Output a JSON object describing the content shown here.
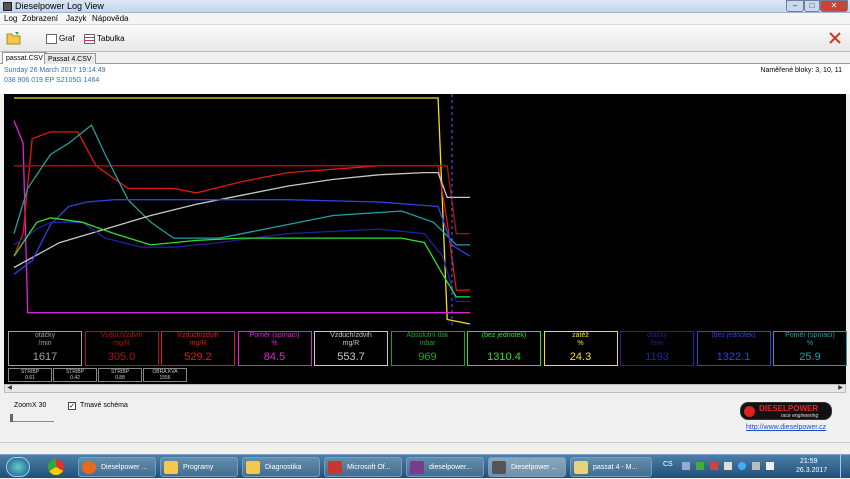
{
  "window": {
    "title": "Dieselpower Log View"
  },
  "menu": [
    "Log",
    "Zobrazení",
    "Jazyk",
    "Nápověda"
  ],
  "toolbar": {
    "graph_label": "Graf",
    "table_label": "Tabulka"
  },
  "tabs": [
    "passat.CSV",
    "Passat 4.CSV"
  ],
  "info": {
    "date": "Sunday 26 March 2017 19:14:49",
    "ecu": "038 906 019 EP  S2105G  1464",
    "measured_blocks": "Naměřené bloky: 3, 10, 11"
  },
  "channels": [
    {
      "name": "otáčky",
      "unit": "/min",
      "value": "1617",
      "color": "#a0a0a0"
    },
    {
      "name": "Vzduch/zdvih",
      "unit": "mg/R",
      "value": "305.0",
      "color": "#b01010"
    },
    {
      "name": "Vzduch/zdvih",
      "unit": "mg/R",
      "value": "529.2",
      "color": "#e01818"
    },
    {
      "name": "Poměr (spínací)",
      "unit": "%",
      "value": "84.5",
      "color": "#e020e0"
    },
    {
      "name": "Vzduch/zdvih",
      "unit": "mg/R",
      "value": "553.7",
      "color": "#c8c8c8"
    },
    {
      "name": "Absolutní tlak",
      "unit": "mbar",
      "value": "969",
      "color": "#20a020"
    },
    {
      "name": "(bez jednotek)",
      "unit": "",
      "value": "1310.4",
      "color": "#30e030"
    },
    {
      "name": "zátěž",
      "unit": "%",
      "value": "24.3",
      "color": "#f0e020"
    },
    {
      "name": "otáčky",
      "unit": "/min",
      "value": "1193",
      "color": "#2020a0"
    },
    {
      "name": "(bez jednotek)",
      "unit": "",
      "value": "1322.1",
      "color": "#3040e0"
    },
    {
      "name": "Poměr (spínací)",
      "unit": "%",
      "value": "25.9",
      "color": "#20a0a0"
    }
  ],
  "stat_boxes": [
    {
      "label": "STRIBP",
      "value": "0.61"
    },
    {
      "label": "STRIBP",
      "value": "0.42"
    },
    {
      "label": "STRIBP",
      "value": "0.88"
    },
    {
      "label": "OBRA.KVA",
      "value": "1556"
    }
  ],
  "bottom": {
    "zoom_label": "Zoom",
    "zoom_value": "X 30",
    "dark_scheme_label": "Tmavé schéma",
    "dark_scheme_checked": true,
    "logo_text": "DIESELPOWER",
    "logo_sub": "race engineering",
    "url": "http://www.dieselpower.cz"
  },
  "taskbar": {
    "items": [
      "Dieselpower ...",
      "Programy",
      "Diagnostika",
      "Microsoft Of...",
      "dieselpower...",
      "Dieselpower ...",
      "passat 4 - M..."
    ],
    "lang": "CS",
    "time": "21:59",
    "date": "26.3.2017"
  },
  "chart_data": {
    "type": "line",
    "x_range": [
      0,
      100
    ],
    "y_range": [
      0,
      100
    ],
    "grid": false,
    "series": [
      {
        "color": "#f0e020",
        "points": [
          [
            0,
            100
          ],
          [
            5,
            100
          ],
          [
            60,
            100
          ],
          [
            93,
            100
          ],
          [
            95,
            2
          ],
          [
            100,
            0
          ]
        ]
      },
      {
        "color": "#e020e0",
        "points": [
          [
            0,
            90
          ],
          [
            2,
            80
          ],
          [
            3,
            5
          ],
          [
            20,
            5
          ],
          [
            40,
            5
          ],
          [
            60,
            5
          ],
          [
            95,
            5
          ],
          [
            100,
            5
          ]
        ]
      },
      {
        "color": "#e01818",
        "points": [
          [
            0,
            30
          ],
          [
            2,
            40
          ],
          [
            4,
            82
          ],
          [
            8,
            85
          ],
          [
            14,
            85
          ],
          [
            18,
            70
          ],
          [
            25,
            60
          ],
          [
            35,
            60
          ],
          [
            40,
            58
          ],
          [
            50,
            63
          ],
          [
            60,
            67
          ],
          [
            80,
            70
          ],
          [
            93,
            70
          ],
          [
            95,
            45
          ],
          [
            97,
            15
          ],
          [
            100,
            15
          ]
        ]
      },
      {
        "color": "#b01010",
        "points": [
          [
            0,
            70
          ],
          [
            3,
            70
          ],
          [
            40,
            70
          ],
          [
            60,
            70
          ],
          [
            93,
            70
          ],
          [
            95,
            70
          ],
          [
            97,
            40
          ],
          [
            100,
            40
          ]
        ]
      },
      {
        "color": "#20a0a0",
        "points": [
          [
            0,
            40
          ],
          [
            3,
            60
          ],
          [
            8,
            75
          ],
          [
            12,
            80
          ],
          [
            17,
            88
          ],
          [
            20,
            75
          ],
          [
            25,
            55
          ],
          [
            30,
            45
          ],
          [
            35,
            38
          ],
          [
            45,
            38
          ],
          [
            55,
            42
          ],
          [
            70,
            48
          ],
          [
            85,
            50
          ],
          [
            92,
            45
          ],
          [
            97,
            35
          ],
          [
            100,
            35
          ]
        ]
      },
      {
        "color": "#c8c8c8",
        "points": [
          [
            0,
            25
          ],
          [
            10,
            36
          ],
          [
            20,
            42
          ],
          [
            30,
            48
          ],
          [
            40,
            53
          ],
          [
            50,
            57
          ],
          [
            60,
            61
          ],
          [
            70,
            64
          ],
          [
            80,
            66
          ],
          [
            90,
            67
          ],
          [
            93,
            67
          ],
          [
            95,
            56
          ],
          [
            100,
            56
          ]
        ]
      },
      {
        "color": "#3040e0",
        "points": [
          [
            0,
            22
          ],
          [
            4,
            28
          ],
          [
            8,
            44
          ],
          [
            12,
            52
          ],
          [
            16,
            54
          ],
          [
            22,
            55
          ],
          [
            30,
            55
          ],
          [
            40,
            55
          ],
          [
            60,
            55
          ],
          [
            80,
            54
          ],
          [
            93,
            52
          ],
          [
            96,
            35
          ],
          [
            100,
            30
          ]
        ]
      },
      {
        "color": "#2020a0",
        "points": [
          [
            0,
            35
          ],
          [
            5,
            42
          ],
          [
            8,
            45
          ],
          [
            15,
            45
          ],
          [
            20,
            38
          ],
          [
            28,
            34
          ],
          [
            35,
            34
          ],
          [
            45,
            36
          ],
          [
            60,
            40
          ],
          [
            80,
            42
          ],
          [
            90,
            40
          ],
          [
            94,
            30
          ],
          [
            97,
            10
          ],
          [
            100,
            10
          ]
        ]
      },
      {
        "color": "#30e030",
        "points": [
          [
            0,
            30
          ],
          [
            5,
            45
          ],
          [
            8,
            47
          ],
          [
            15,
            45
          ],
          [
            22,
            40
          ],
          [
            30,
            35
          ],
          [
            40,
            37
          ],
          [
            50,
            38
          ],
          [
            70,
            38
          ],
          [
            85,
            38
          ],
          [
            90,
            36
          ],
          [
            94,
            22
          ],
          [
            97,
            12
          ],
          [
            100,
            12
          ]
        ]
      }
    ]
  }
}
